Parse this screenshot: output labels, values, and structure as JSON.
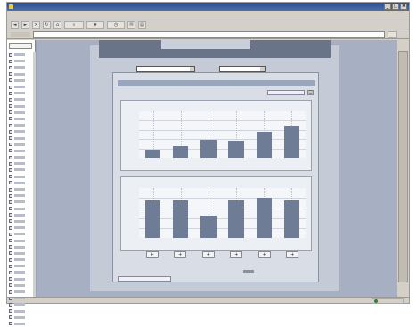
{
  "window": {
    "title": "",
    "buttons": [
      "_",
      "□",
      "×"
    ]
  },
  "menubar": {
    "items": [
      "",
      "",
      "",
      "",
      "",
      ""
    ]
  },
  "toolbar": {
    "buttons": [
      "back",
      "forward",
      "stop",
      "refresh",
      "home",
      "search",
      "favorites",
      "history",
      "mail",
      "print"
    ]
  },
  "addressbar": {
    "label": "",
    "url": ""
  },
  "tree": {
    "combo": "",
    "node_count": 43
  },
  "content": {
    "combo_left": "",
    "combo_right": "",
    "panel_title": "",
    "panel_button": "",
    "chart_top_title": "",
    "chart_bottom_title": "",
    "legend": [
      "",
      ""
    ],
    "markers": [
      "+",
      "+",
      "+",
      "+",
      "+",
      "+"
    ]
  },
  "status": {
    "text": "",
    "zone": ""
  },
  "chart_data": [
    {
      "type": "bar",
      "title": "",
      "categories": [
        "",
        "",
        "",
        "",
        "",
        ""
      ],
      "values": [
        15,
        22,
        35,
        33,
        50,
        62
      ],
      "ylim": [
        0,
        90
      ],
      "grid": true
    },
    {
      "type": "bar",
      "title": "",
      "categories": [
        "",
        "",
        "",
        "",
        "",
        ""
      ],
      "values": [
        75,
        75,
        45,
        75,
        80,
        75
      ],
      "ylim": [
        0,
        100
      ],
      "grid": true
    }
  ]
}
